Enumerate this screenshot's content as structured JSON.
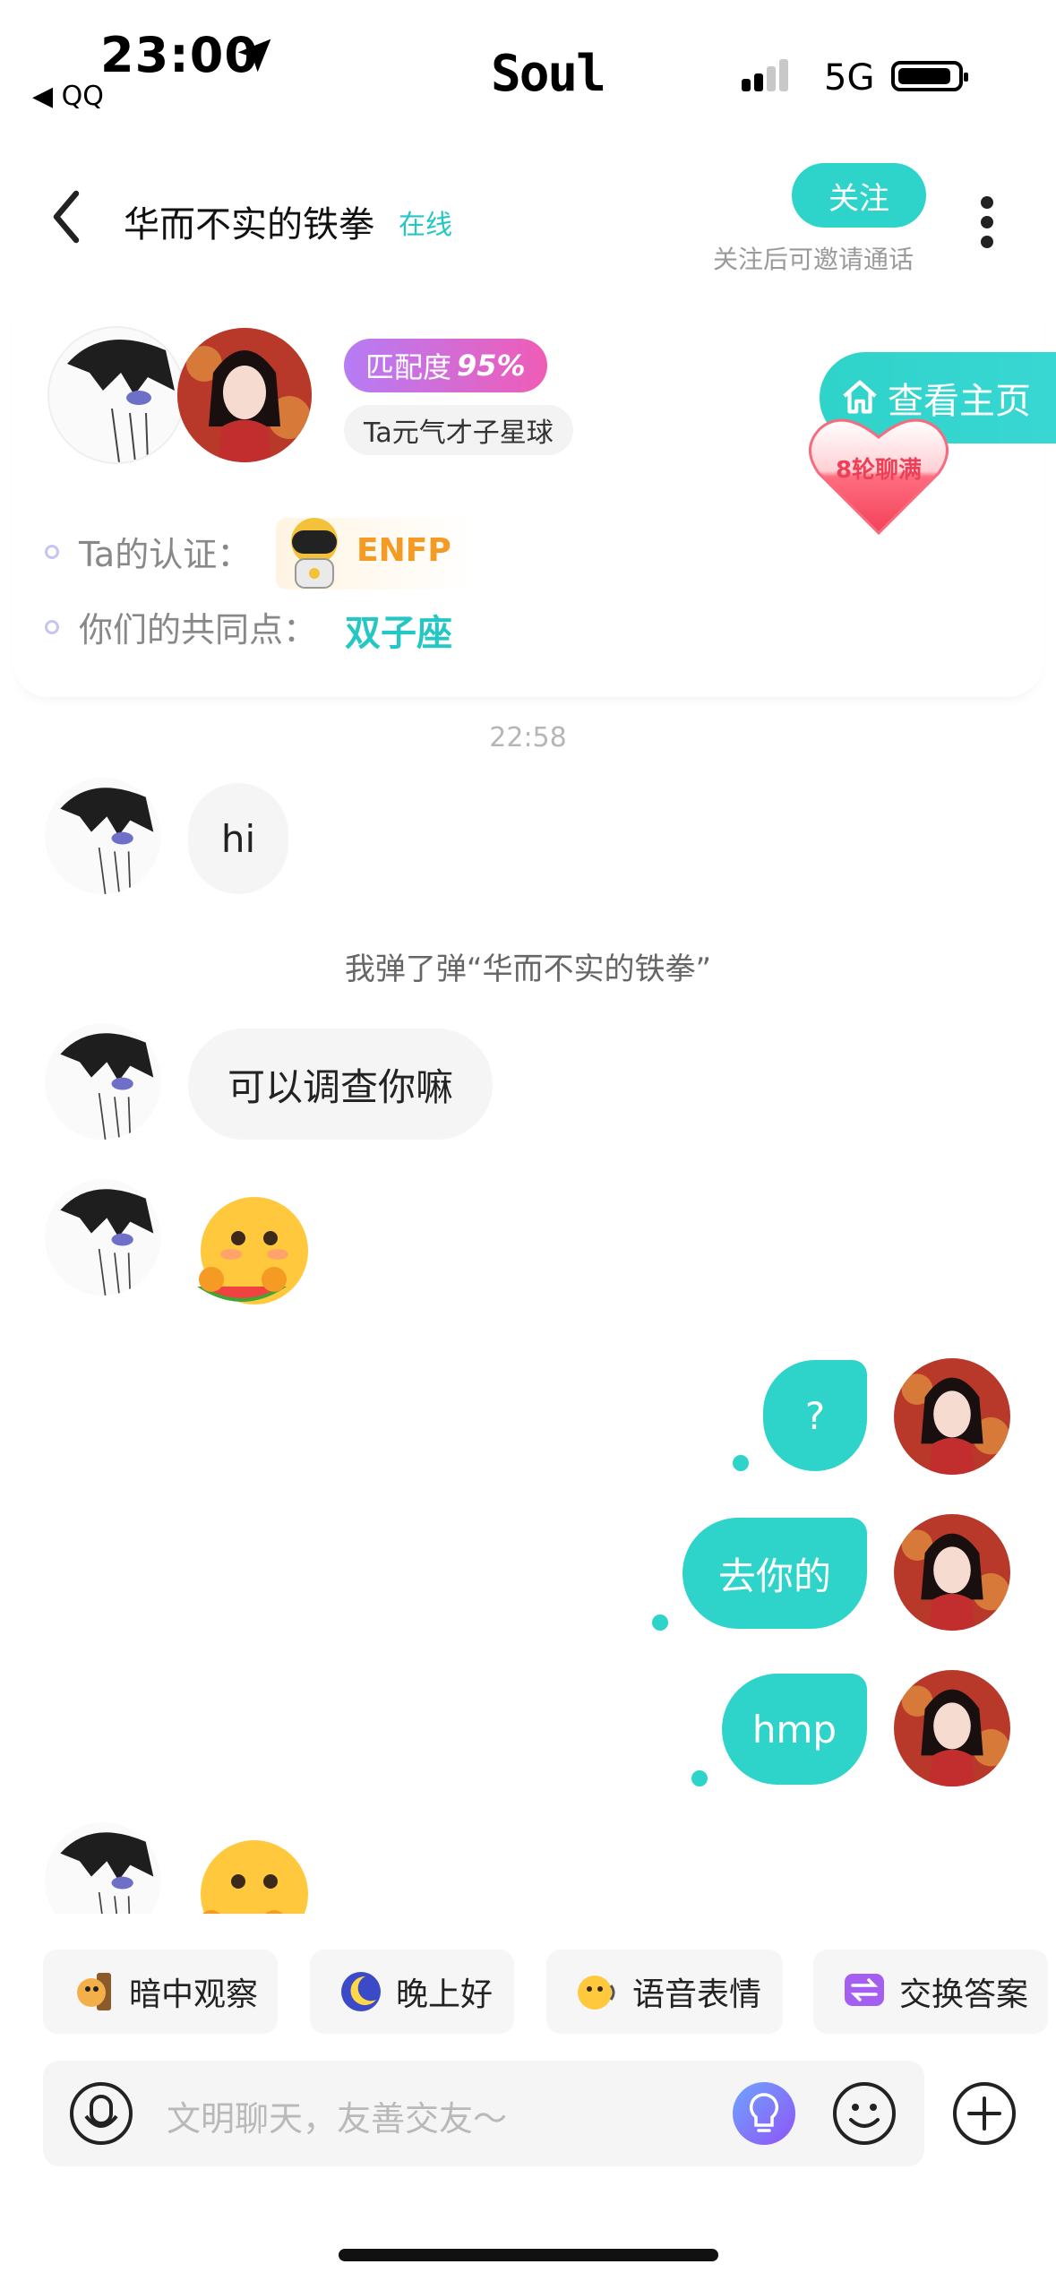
{
  "status_bar": {
    "time": "23:00",
    "back_app": "◀ QQ",
    "app_logo": "Soul",
    "network": "5G"
  },
  "nav": {
    "title": "华而不实的铁拳",
    "online_status": "在线",
    "follow_label": "关注",
    "follow_hint": "关注后可邀请通话"
  },
  "profile": {
    "match_label": "匹配度",
    "match_value": "95%",
    "planet": "Ta元气才子星球",
    "home_button": "查看主页",
    "heart_label": "8轮聊满",
    "cert_label": "Ta的认证：",
    "mbti": "ENFP",
    "common_label": "你们的共同点：",
    "common_value": "双子座"
  },
  "chat": {
    "timestamp": "22:58",
    "system_message": "我弹了弹“华而不实的铁拳”",
    "messages": [
      {
        "from": "other",
        "text": "hi"
      },
      {
        "from": "other",
        "text": "可以调查你嘛"
      },
      {
        "from": "other",
        "emoji": "blush-eating-watermelon"
      },
      {
        "from": "me",
        "text": "?"
      },
      {
        "from": "me",
        "text": "去你的"
      },
      {
        "from": "me",
        "text": "hmp"
      },
      {
        "from": "other",
        "emoji": "blush-eating-watermelon"
      }
    ]
  },
  "quick_actions": [
    {
      "label": "暗中观察",
      "icon": "peeking-dog-icon"
    },
    {
      "label": "晚上好",
      "icon": "moon-icon"
    },
    {
      "label": "语音表情",
      "icon": "voice-emoji-icon"
    },
    {
      "label": "交换答案",
      "icon": "exchange-icon"
    }
  ],
  "composer": {
    "placeholder": "文明聊天，友善交友～"
  },
  "colors": {
    "accent": "#2ed3c9",
    "mbti": "#f59a23",
    "heart": "#ee3f57"
  }
}
